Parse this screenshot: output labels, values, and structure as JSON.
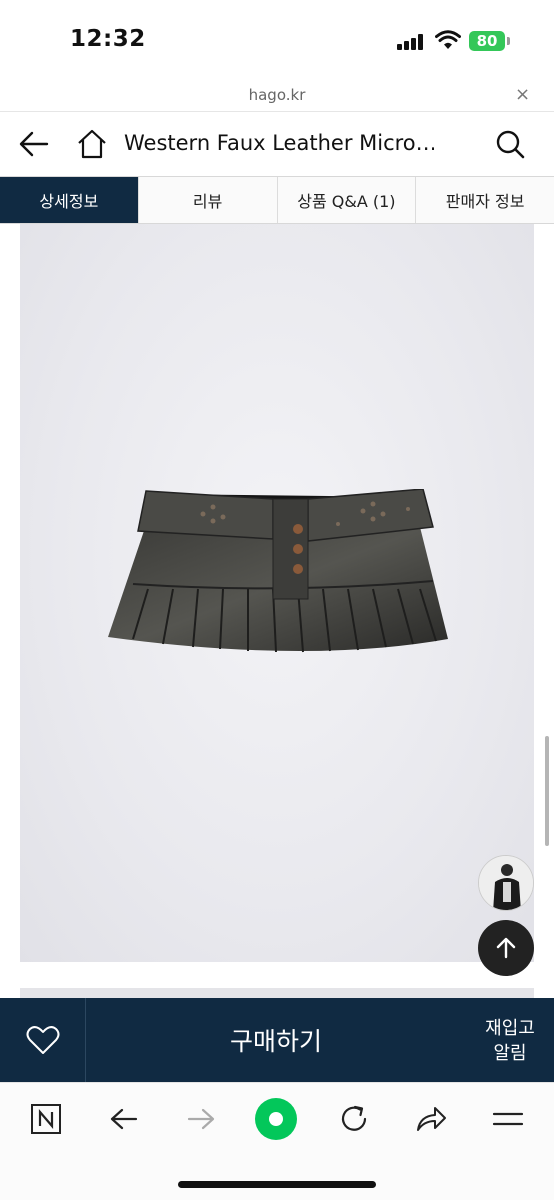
{
  "status_bar": {
    "time": "12:32",
    "battery_level": "80",
    "battery_color": "#34c759"
  },
  "url_bar": {
    "domain": "hago.kr",
    "close_symbol": "×"
  },
  "header": {
    "title": "Western Faux Leather Micro…",
    "icons": [
      "back-arrow-icon",
      "home-icon",
      "search-icon"
    ]
  },
  "tabs": [
    {
      "label": "상세정보",
      "active": true
    },
    {
      "label": "리뷰",
      "active": false
    },
    {
      "label": "상품 Q&A (1)",
      "active": false
    },
    {
      "label": "판매자 정보",
      "active": false
    }
  ],
  "buy_bar": {
    "buy_label": "구매하기",
    "restock_line1": "재입고",
    "restock_line2": "알림",
    "background_color": "#102a42"
  },
  "browser_toolbar": {
    "items": [
      "naver-n-icon",
      "back-icon",
      "forward-icon",
      "green-dot-icon",
      "reload-icon",
      "share-icon",
      "menu-icon"
    ],
    "accent_color": "#03c75a"
  }
}
